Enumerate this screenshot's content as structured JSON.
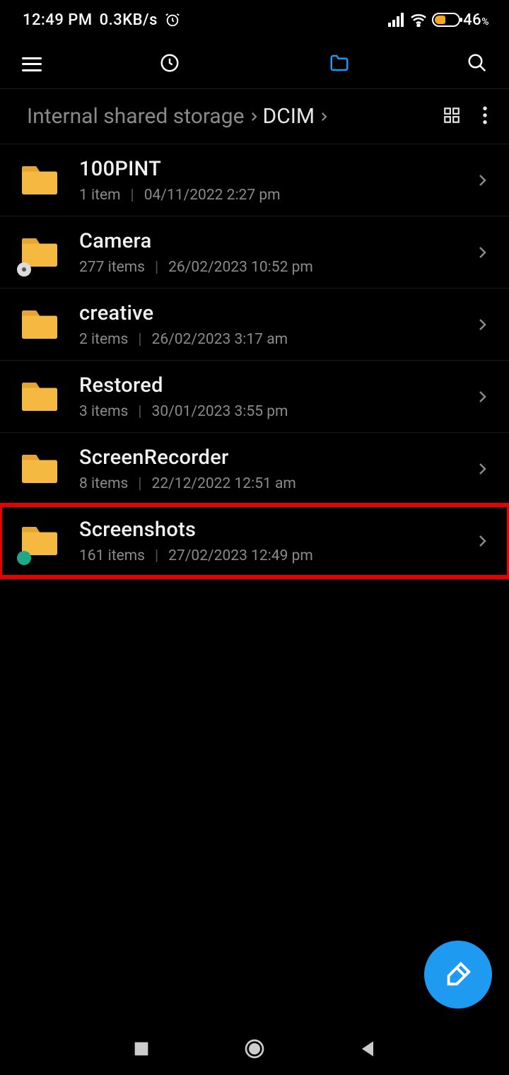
{
  "status": {
    "time": "12:49 PM",
    "net_speed": "0.3KB/s",
    "battery_pct": "46",
    "battery_suffix": "%"
  },
  "breadcrumb": {
    "crumb_root": "Internal shared storage",
    "crumb_current": "DCIM"
  },
  "folders": [
    {
      "name": "100PINT",
      "items": "1 item",
      "date": "04/11/2022 2:27 pm",
      "badge": ""
    },
    {
      "name": "Camera",
      "items": "277 items",
      "date": "26/02/2023 10:52 pm",
      "badge": "grey"
    },
    {
      "name": "creative",
      "items": "2 items",
      "date": "26/02/2023 3:17 am",
      "badge": ""
    },
    {
      "name": "Restored",
      "items": "3 items",
      "date": "30/01/2023 3:55 pm",
      "badge": ""
    },
    {
      "name": "ScreenRecorder",
      "items": "8 items",
      "date": "22/12/2022 12:51 am",
      "badge": ""
    },
    {
      "name": "Screenshots",
      "items": "161 items",
      "date": "27/02/2023 12:49 pm",
      "badge": "teal"
    }
  ],
  "highlighted_index": 5
}
